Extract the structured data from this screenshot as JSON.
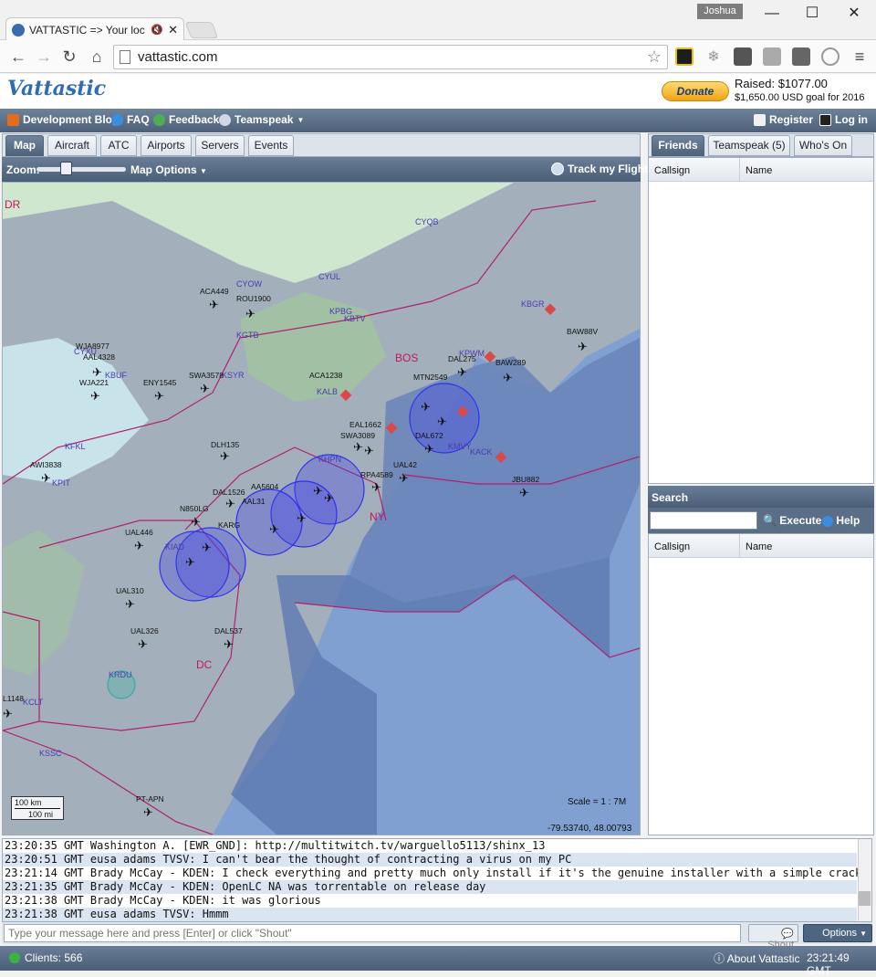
{
  "browser": {
    "tab_title": "VATTASTIC => Your loc",
    "user_label": "Joshua",
    "url": "vattastic.com"
  },
  "site": {
    "logo_text": "Vattastic",
    "donate_label": "Donate",
    "raised_text": "Raised: $1077.00",
    "goal_text": "$1,650.00 USD goal for 2016",
    "nav": {
      "dev_blog": "Development Blog",
      "faq": "FAQ",
      "feedback": "Feedback",
      "teamspeak": "Teamspeak",
      "register": "Register",
      "login": "Log in"
    }
  },
  "left_tabs": [
    "Map",
    "Aircraft",
    "ATC",
    "Airports",
    "Servers",
    "Events"
  ],
  "map_toolbar": {
    "zoom_label": "Zoom:",
    "map_options": "Map Options",
    "track_label": "Track my Flight"
  },
  "map": {
    "scale_text": "Scale = 1 : 7M",
    "coords_text": "-79.53740, 48.00793",
    "scale_km": "100 km",
    "scale_mi": "100 mi",
    "region_labels": [
      "BOS",
      "NY",
      "DC",
      "DR"
    ],
    "airports": [
      "CYQB",
      "CYOW",
      "CYUL",
      "KPBG",
      "KBTV",
      "KBGR",
      "KGTB",
      "KSYR",
      "CYXU",
      "KBUF",
      "KFKL",
      "KPIT",
      "KALB",
      "KPWM",
      "KACK",
      "KMVY",
      "KHPN",
      "KIAD",
      "KRDU",
      "KCLT",
      "KSSC"
    ],
    "aircraft": [
      "ACA449",
      "ROU1900",
      "BAW88V",
      "DAL275",
      "BAW289",
      "KPWM",
      "MTN2549",
      "ACA1238",
      "WJA8977",
      "AAL4328",
      "WJA221",
      "ENY1545",
      "SWA3578",
      "DLH135",
      "AWI3838",
      "DAL1526",
      "N850LG",
      "UAL446",
      "UAL310",
      "UAL326",
      "DAL537",
      "UAL42",
      "JBU882",
      "PT-APN",
      "SWA3089",
      "EAL1662",
      "RPA4589",
      "AAL31",
      "AA5604",
      "KARG",
      "L1148",
      "DAL672"
    ]
  },
  "right_tabs": [
    "Friends",
    "Teamspeak (5)",
    "Who's On"
  ],
  "friends_table": {
    "col1": "Callsign",
    "col2": "Name"
  },
  "search": {
    "title": "Search",
    "execute": "Execute",
    "help": "Help",
    "col1": "Callsign",
    "col2": "Name"
  },
  "chat": {
    "lines": [
      "23:20:35 GMT  Washington A. [EWR_GND]: http://multitwitch.tv/warguello5113/shinx_13",
      "23:20:51 GMT  eusa adams TVSV: I can't bear the thought of contracting a virus on my PC",
      "23:21:14 GMT  Brady McCay - KDEN: I check everything and pretty much only install if it's the genuine installer with a simple crack",
      "23:21:35 GMT  Brady McCay - KDEN: OpenLC NA was torrentable on release day",
      "23:21:38 GMT  Brady McCay - KDEN: it was glorious",
      "23:21:38 GMT  eusa adams TVSV: Hmmm"
    ],
    "placeholder": "Type your message here and press [Enter] or click \"Shout\"",
    "shout_label": "Shout",
    "options_label": "Options"
  },
  "status": {
    "clients": "Clients: 566",
    "about": "About Vattastic",
    "clock": "23:21:49 GMT"
  },
  "colors": {
    "accent": "#4a5e78",
    "ocean": "#7e9fcf",
    "land": "#a3b0bc",
    "boundary": "#b0206e",
    "atc_ring": "#3a3af0"
  }
}
